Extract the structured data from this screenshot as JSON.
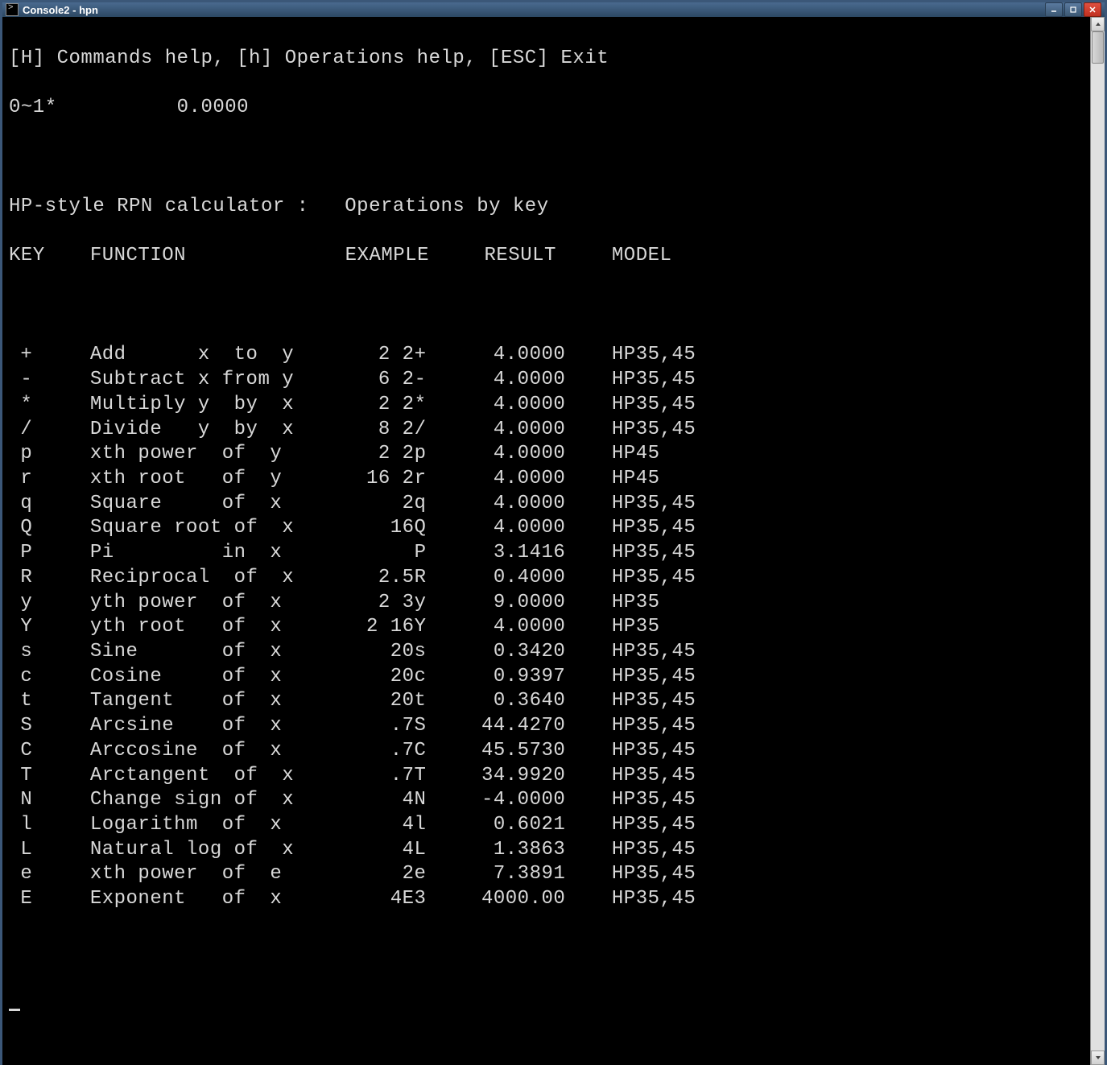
{
  "window": {
    "title": "Console2 - hpn"
  },
  "header": {
    "help_line": "[H] Commands help, [h] Operations help, [ESC] Exit",
    "status": "0~1*          0.0000"
  },
  "title_line": "HP-style RPN calculator :   Operations by key",
  "columns": {
    "key": "KEY",
    "func": "FUNCTION",
    "example": "EXAMPLE",
    "result": "RESULT",
    "model": "MODEL"
  },
  "rows": [
    {
      "key": "+",
      "func": "Add      x  to  y",
      "example": "2 2+",
      "result": "4.0000",
      "model": "HP35,45"
    },
    {
      "key": "-",
      "func": "Subtract x from y",
      "example": "6 2-",
      "result": "4.0000",
      "model": "HP35,45"
    },
    {
      "key": "*",
      "func": "Multiply y  by  x",
      "example": "2 2*",
      "result": "4.0000",
      "model": "HP35,45"
    },
    {
      "key": "/",
      "func": "Divide   y  by  x",
      "example": "8 2/",
      "result": "4.0000",
      "model": "HP35,45"
    },
    {
      "key": "p",
      "func": "xth power  of  y",
      "example": "2 2p",
      "result": "4.0000",
      "model": "HP45"
    },
    {
      "key": "r",
      "func": "xth root   of  y",
      "example": "16 2r",
      "result": "4.0000",
      "model": "HP45"
    },
    {
      "key": "q",
      "func": "Square     of  x",
      "example": "2q",
      "result": "4.0000",
      "model": "HP35,45"
    },
    {
      "key": "Q",
      "func": "Square root of  x",
      "example": "16Q",
      "result": "4.0000",
      "model": "HP35,45"
    },
    {
      "key": "P",
      "func": "Pi         in  x",
      "example": "P",
      "result": "3.1416",
      "model": "HP35,45"
    },
    {
      "key": "R",
      "func": "Reciprocal  of  x",
      "example": "2.5R",
      "result": "0.4000",
      "model": "HP35,45"
    },
    {
      "key": "y",
      "func": "yth power  of  x",
      "example": "2 3y",
      "result": "9.0000",
      "model": "HP35"
    },
    {
      "key": "Y",
      "func": "yth root   of  x",
      "example": "2 16Y",
      "result": "4.0000",
      "model": "HP35"
    },
    {
      "key": "s",
      "func": "Sine       of  x",
      "example": "20s",
      "result": "0.3420",
      "model": "HP35,45"
    },
    {
      "key": "c",
      "func": "Cosine     of  x",
      "example": "20c",
      "result": "0.9397",
      "model": "HP35,45"
    },
    {
      "key": "t",
      "func": "Tangent    of  x",
      "example": "20t",
      "result": "0.3640",
      "model": "HP35,45"
    },
    {
      "key": "S",
      "func": "Arcsine    of  x",
      "example": ".7S",
      "result": "44.4270",
      "model": "HP35,45"
    },
    {
      "key": "C",
      "func": "Arccosine  of  x",
      "example": ".7C",
      "result": "45.5730",
      "model": "HP35,45"
    },
    {
      "key": "T",
      "func": "Arctangent  of  x",
      "example": ".7T",
      "result": "34.9920",
      "model": "HP35,45"
    },
    {
      "key": "N",
      "func": "Change sign of  x",
      "example": "4N",
      "result": "-4.0000",
      "model": "HP35,45"
    },
    {
      "key": "l",
      "func": "Logarithm  of  x",
      "example": "4l",
      "result": "0.6021",
      "model": "HP35,45"
    },
    {
      "key": "L",
      "func": "Natural log of  x",
      "example": "4L",
      "result": "1.3863",
      "model": "HP35,45"
    },
    {
      "key": "e",
      "func": "xth power  of  e",
      "example": "2e",
      "result": "7.3891",
      "model": "HP35,45"
    },
    {
      "key": "E",
      "func": "Exponent   of  x",
      "example": "4E3",
      "result": "4000.00",
      "model": "HP35,45"
    }
  ]
}
